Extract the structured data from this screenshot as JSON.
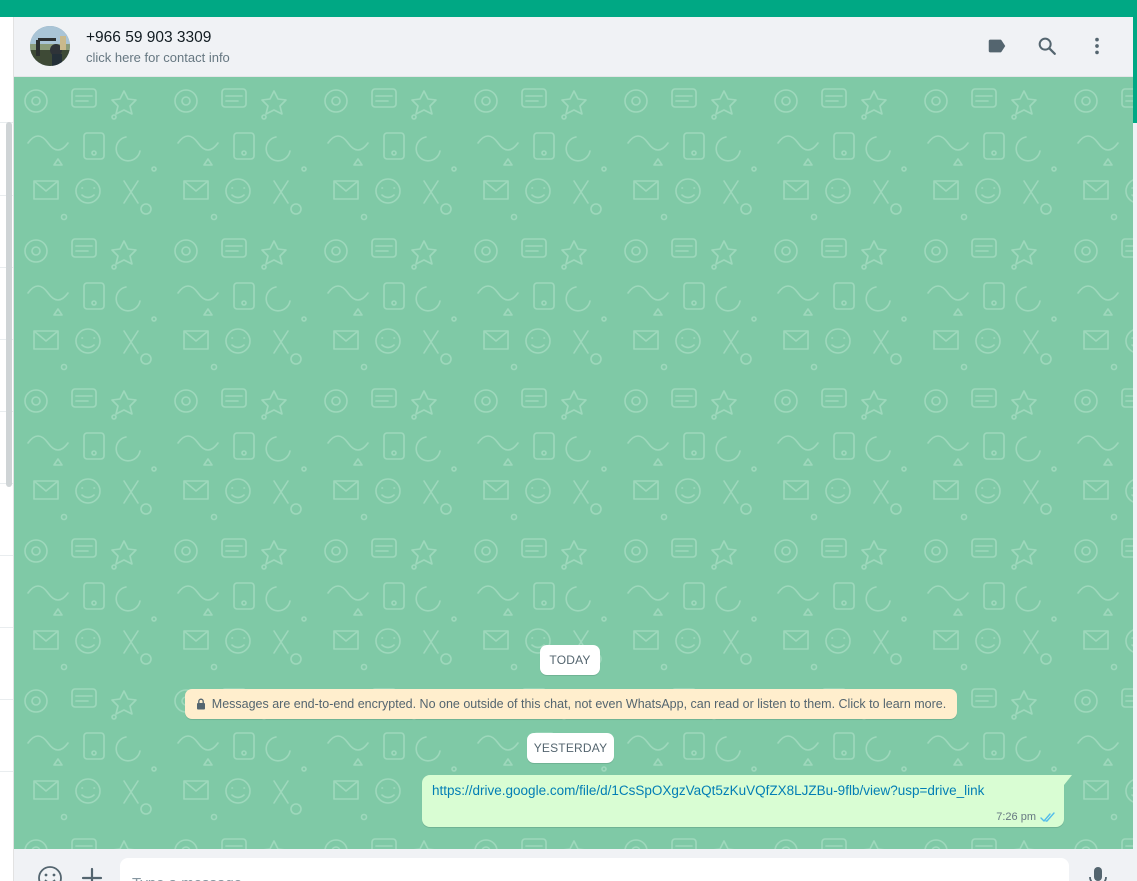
{
  "header": {
    "contact_name": "+966 59 903 3309",
    "contact_subtitle": "click here for contact info",
    "icons": [
      "label-icon",
      "search-icon",
      "menu-icon"
    ]
  },
  "messages": {
    "date_today": "TODAY",
    "encryption_notice": "Messages are end-to-end encrypted. No one outside of this chat, not even WhatsApp, can read or listen to them. Click to learn more.",
    "date_yesterday": "YESTERDAY",
    "outgoing": {
      "text": "https://drive.google.com/file/d/1CsSpOXgzVaQt5zKuVQfZX8LJZBu-9flb/view?usp=drive_link",
      "time": "7:26 pm",
      "status": "read"
    }
  },
  "composer": {
    "placeholder": "Type a message",
    "icons": [
      "emoji-icon",
      "attach-icon",
      "mic-icon"
    ]
  },
  "colors": {
    "accent": "#00a884",
    "wallpaper": "#7fc9a6",
    "outgoing_bubble": "#d9fdd3",
    "encryption_bg": "#ffeecd",
    "link": "#027eb5",
    "read_ticks": "#53bdeb"
  }
}
